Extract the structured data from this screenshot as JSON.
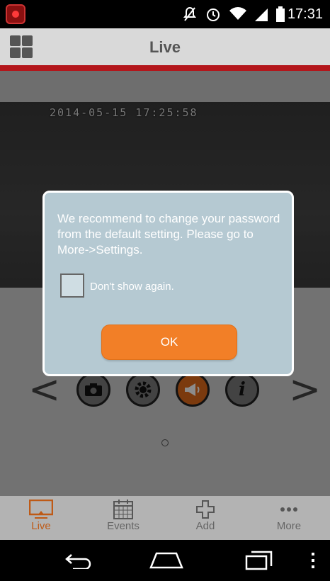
{
  "status_bar": {
    "time": "17:31",
    "icons": [
      "app-notification-icon",
      "mute-icon",
      "alarm-icon",
      "wifi-icon",
      "signal-icon",
      "battery-icon"
    ]
  },
  "header": {
    "title": "Live",
    "menu_icon": "grid-menu-icon",
    "accent_color": "#b3161b"
  },
  "video": {
    "timestamp": "2014-05-15 17:25:58"
  },
  "controls": {
    "items": [
      "camera-icon",
      "settings-icon",
      "speaker-icon",
      "info-icon"
    ],
    "info_glyph": "i",
    "prev_arrow": "<",
    "next_arrow": ">"
  },
  "dialog": {
    "message": "We recommend to change your password from the default setting. Please go to More->Settings.",
    "checkbox_label": "Don't show again.",
    "checkbox_checked": false,
    "ok_label": "OK",
    "button_color": "#f27f27"
  },
  "bottom_nav": {
    "items": [
      {
        "label": "Live",
        "icon": "monitor-icon",
        "active": true
      },
      {
        "label": "Events",
        "icon": "calendar-icon",
        "active": false
      },
      {
        "label": "Add",
        "icon": "plus-icon",
        "active": false
      },
      {
        "label": "More",
        "icon": "more-dots-icon",
        "active": false
      }
    ],
    "active_color": "#e06a1a"
  },
  "system_nav": [
    "back-icon",
    "home-icon",
    "recents-icon",
    "overflow-menu-icon"
  ]
}
